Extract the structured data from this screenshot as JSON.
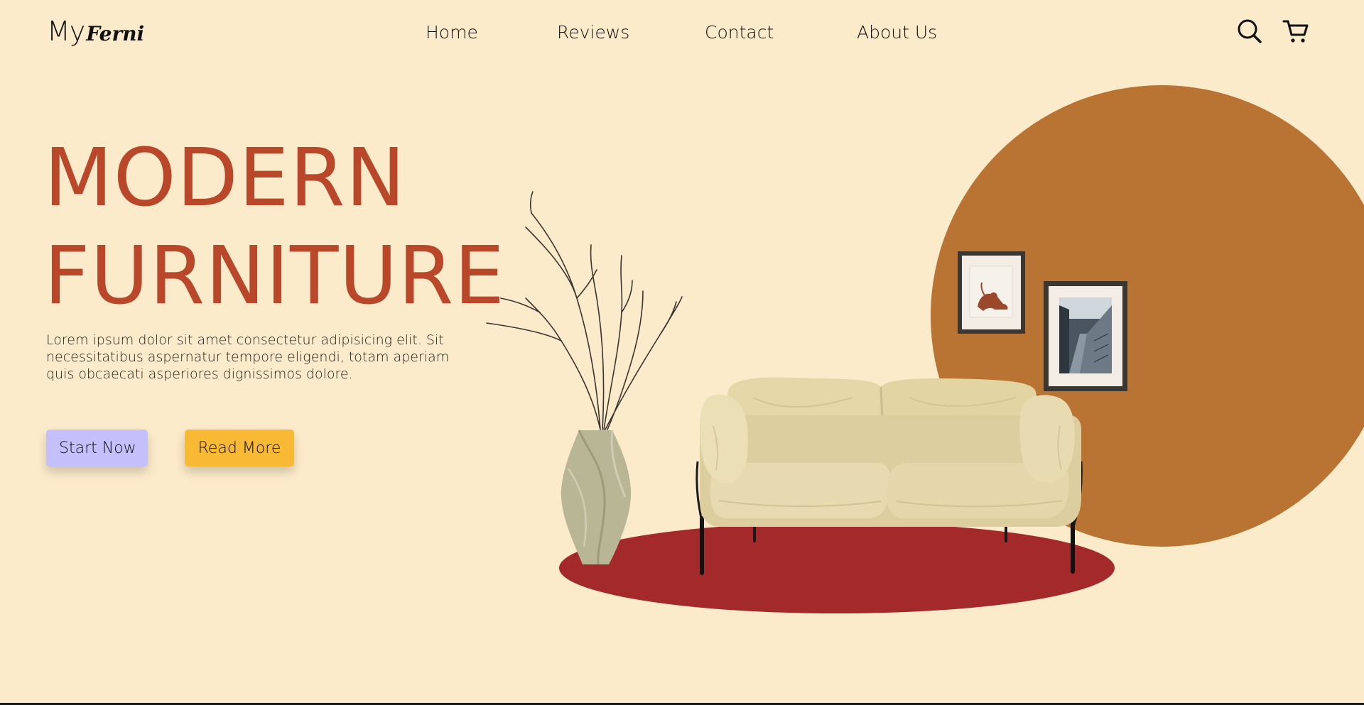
{
  "header": {
    "logo_my": "My",
    "logo_ferni": "Ferni",
    "nav": [
      {
        "label": "Home"
      },
      {
        "label": "Reviews"
      },
      {
        "label": "Contact"
      },
      {
        "label": "About Us"
      }
    ],
    "icons": [
      "search-icon",
      "cart-icon"
    ]
  },
  "hero": {
    "title_line1": "MODERN",
    "title_line2": "FURNITURE",
    "description": "Lorem ipsum dolor sit amet consectetur adipisicing elit. Sit necessitatibus aspernatur tempore eligendi, totam aperiam quis obcaecati asperiores dignissimos dolore.",
    "start_label": "Start Now",
    "read_label": "Read More"
  },
  "colors": {
    "background": "#fcebca",
    "title": "#b9472a",
    "circle": "#b97332",
    "rug": "#a3292b",
    "start_button": "#c4c0fb",
    "read_button": "#f8b935",
    "sofa": "#e6d7a8",
    "vase": "#b9b696"
  }
}
